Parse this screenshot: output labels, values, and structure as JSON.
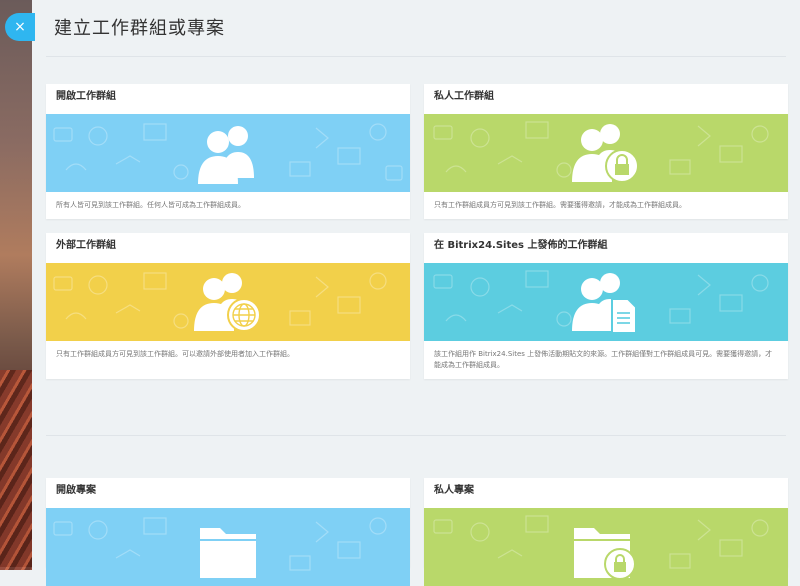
{
  "dialog": {
    "title": "建立工作群組或專案",
    "close_icon": "×"
  },
  "colors": {
    "blue": "#7fd0f5",
    "green": "#b9d86a",
    "yellow": "#f2d04a",
    "teal": "#5ccde0",
    "accent": "#2fb6f0"
  },
  "cards": [
    {
      "title": "開啟工作群組",
      "desc": "所有人皆可見到該工作群組。任何人皆可成為工作群組成員。",
      "color": "blue",
      "icon": "group-icon"
    },
    {
      "title": "私人工作群組",
      "desc": "只有工作群組成員方可見到該工作群組。需要獲得邀請，才能成為工作群組成員。",
      "color": "green",
      "icon": "group-lock-icon"
    },
    {
      "title": "外部工作群組",
      "desc": "只有工作群組成員方可見到該工作群組。可以邀請外部使用者加入工作群組。",
      "color": "yellow",
      "icon": "group-globe-icon"
    },
    {
      "title": "在 Bitrix24.Sites 上發佈的工作群組",
      "desc": "該工作組用作 Bitrix24.Sites 上發佈活動期貼文的來源。工作群組僅對工作群組成員可見。需要獲得邀請，才能成為工作群組成員。",
      "color": "teal",
      "icon": "group-document-icon"
    },
    {
      "title": "開啟專案",
      "desc": "",
      "color": "blue",
      "icon": "folder-icon"
    },
    {
      "title": "私人專案",
      "desc": "",
      "color": "green",
      "icon": "folder-lock-icon"
    }
  ]
}
